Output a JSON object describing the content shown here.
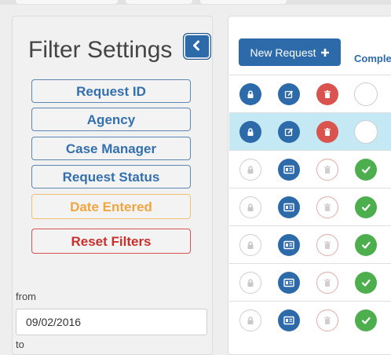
{
  "filter_panel": {
    "title": "Filter Settings",
    "buttons": [
      {
        "label": "Request ID",
        "style": "primary"
      },
      {
        "label": "Agency",
        "style": "primary"
      },
      {
        "label": "Case Manager",
        "style": "primary"
      },
      {
        "label": "Request Status",
        "style": "primary"
      },
      {
        "label": "Date Entered",
        "style": "warning"
      },
      {
        "label": "Reset Filters",
        "style": "danger"
      }
    ],
    "from_label": "from",
    "from_value": "09/02/2016",
    "to_label": "to"
  },
  "requests": {
    "new_request_label": "New Request",
    "complete_header": "Comple",
    "rows": [
      {
        "state": "active",
        "selected": false,
        "complete": false
      },
      {
        "state": "active",
        "selected": true,
        "complete": false
      },
      {
        "state": "locked",
        "selected": false,
        "complete": true
      },
      {
        "state": "locked",
        "selected": false,
        "complete": true
      },
      {
        "state": "locked",
        "selected": false,
        "complete": true
      },
      {
        "state": "locked",
        "selected": false,
        "complete": true
      },
      {
        "state": "locked",
        "selected": false,
        "complete": true
      }
    ]
  },
  "colors": {
    "primary": "#2c6aaa",
    "danger": "#d9534f",
    "success": "#4cae4c",
    "warning": "#f0a640",
    "selected_row": "#c5e9f4"
  }
}
